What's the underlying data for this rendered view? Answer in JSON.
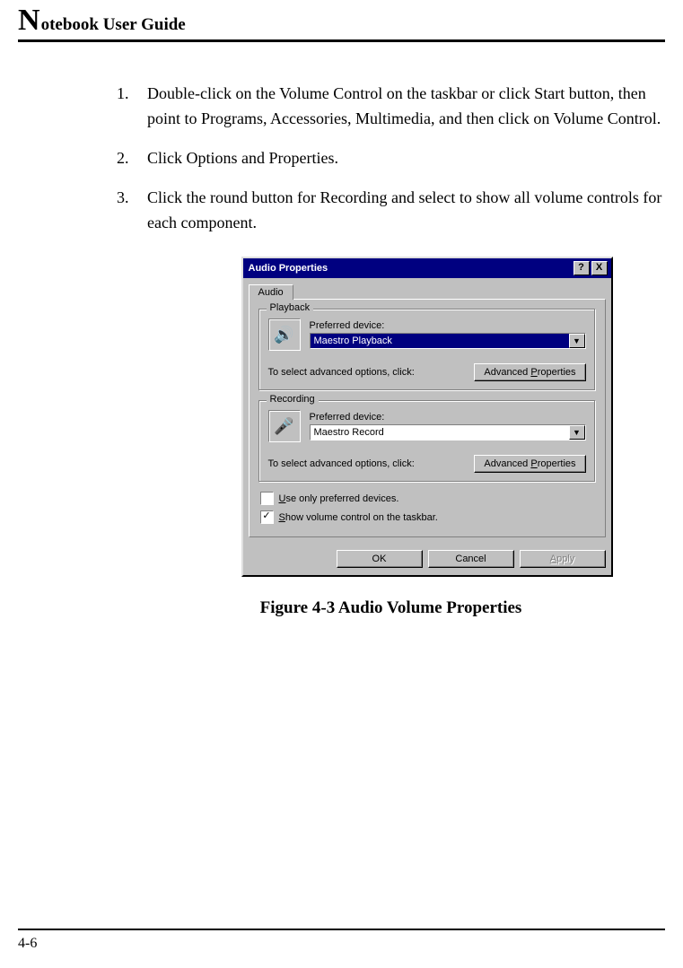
{
  "header": {
    "dropcap": "N",
    "rest": "otebook User Guide"
  },
  "steps": [
    {
      "num": "1.",
      "text": "Double-click on the Volume Control on the taskbar or click Start button, then point to Programs, Accessories, Multimedia, and then click on Volume Control."
    },
    {
      "num": "2.",
      "text": "Click Options and Properties."
    },
    {
      "num": "3.",
      "text": "Click the round button for Recording and select to show all volume controls for each component."
    }
  ],
  "dialog": {
    "title": "Audio Properties",
    "help_btn": "?",
    "close_btn": "X",
    "tab": "Audio",
    "playback": {
      "legend": "Playback",
      "label": "Preferred device:",
      "value": "Maestro Playback",
      "adv_label": "To select advanced options, click:",
      "adv_btn_pre": "Advanced ",
      "adv_btn_u": "P",
      "adv_btn_post": "roperties",
      "icon": "🔊"
    },
    "recording": {
      "legend": "Recording",
      "label": "Preferred device:",
      "value": "Maestro Record",
      "adv_label": "To select advanced options, click:",
      "adv_btn_pre": "Advanced ",
      "adv_btn_u": "P",
      "adv_btn_post": "roperties",
      "icon": "🎤"
    },
    "check1_u": "U",
    "check1_rest": "se only preferred devices.",
    "check2_u": "S",
    "check2_rest": "how volume control on the taskbar.",
    "check2_mark": "✓",
    "ok": "OK",
    "cancel": "Cancel",
    "apply_u": "A",
    "apply_rest": "pply"
  },
  "caption": "Figure 4-3  Audio Volume Properties",
  "pagenum": "4-6"
}
